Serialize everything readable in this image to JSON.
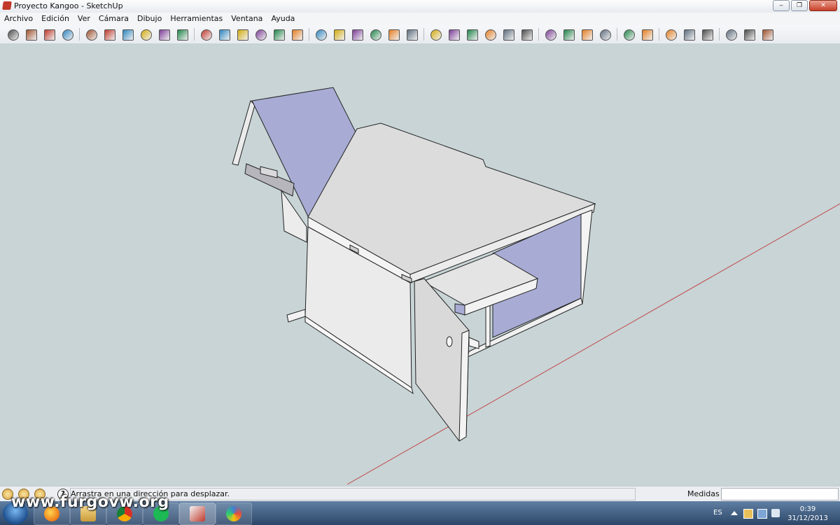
{
  "window": {
    "title": "Proyecto Kangoo - SketchUp",
    "controls": [
      "‒",
      "❐",
      "✕"
    ]
  },
  "menu": {
    "items": [
      "Archivo",
      "Edición",
      "Ver",
      "Cámara",
      "Dibujo",
      "Herramientas",
      "Ventana",
      "Ayuda"
    ]
  },
  "toolbar": {
    "tools": [
      "select-tool",
      "make-component-tool",
      "paint-bucket-tool",
      "eraser-tool",
      "rectangle-tool",
      "line-tool",
      "circle-tool",
      "arc-tool",
      "polygon-tool",
      "freehand-tool",
      "move-tool",
      "push-pull-tool",
      "rotate-tool",
      "follow-me-tool",
      "scale-tool",
      "offset-tool",
      "tape-measure-tool",
      "dimension-tool",
      "protractor-tool",
      "text-tool",
      "axes-tool",
      "3d-text-tool",
      "orbit-tool",
      "pan-tool",
      "zoom-tool",
      "zoom-window-tool",
      "zoom-extents-tool",
      "previous-view-tool",
      "position-camera-tool",
      "look-around-tool",
      "walk-tool",
      "section-plane-tool",
      "get-models-tool",
      "share-model-tool",
      "add-location-tool",
      "toggle-terrain-tool",
      "photo-textures-tool",
      "get-photo-texture-tool",
      "3d-warehouse-tool",
      "extension-warehouse-tool"
    ]
  },
  "status": {
    "hint": "Arrastra en una dirección para desplazar.",
    "help": "?",
    "measure_label": "Medidas",
    "measure_value": ""
  },
  "taskbar": {
    "apps": [
      "firefox-icon",
      "explorer-icon",
      "chrome-icon",
      "spotify-icon",
      "sketchup-icon",
      "paint-icon"
    ],
    "language": "ES",
    "time": "0:39",
    "date": "31/12/2013"
  },
  "watermark": "www.furgovw.org"
}
